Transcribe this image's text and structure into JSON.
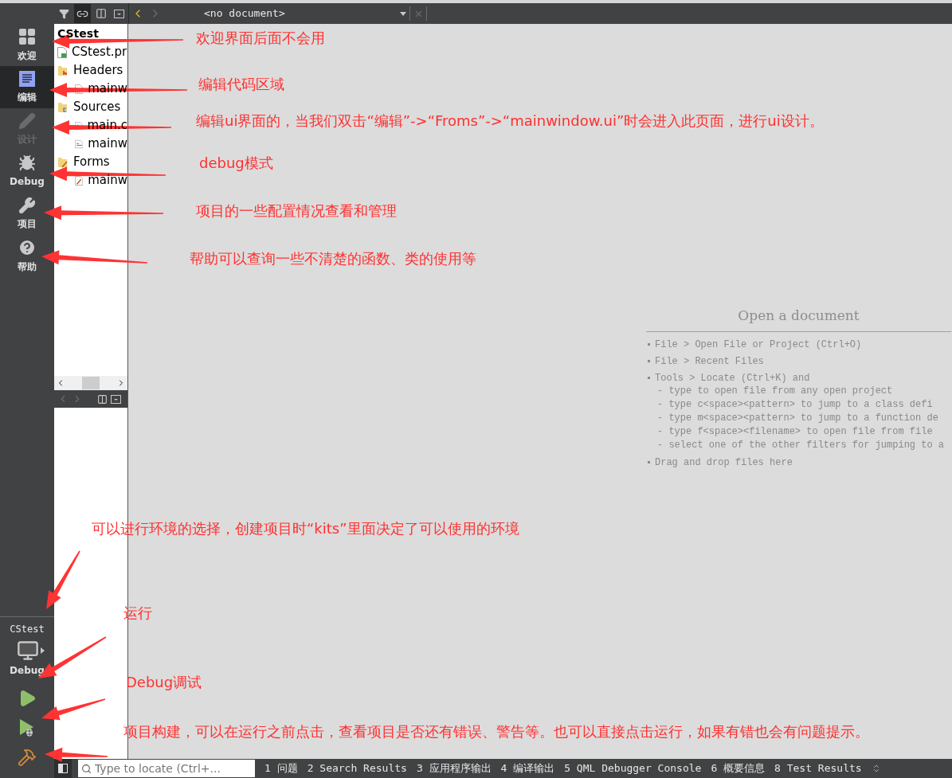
{
  "top_toolbar": {
    "buttons": [
      {
        "kind": "filter",
        "selected": false
      },
      {
        "kind": "link",
        "selected": true
      },
      {
        "kind": "split",
        "selected": false
      },
      {
        "kind": "close-panel",
        "selected": false
      }
    ]
  },
  "editor_toolbar": {
    "nav": [
      {
        "kind": "back",
        "disabled": false
      },
      {
        "kind": "forward",
        "disabled": true
      }
    ],
    "document_combo": {
      "value": "<no document>"
    },
    "close_button": {
      "disabled": true
    }
  },
  "mode_bar": {
    "modes": [
      {
        "label": "欢迎",
        "kind": "welcome",
        "selected": false,
        "disabled": false
      },
      {
        "label": "编辑",
        "kind": "edit",
        "selected": true,
        "disabled": false
      },
      {
        "label": "设计",
        "kind": "design",
        "selected": false,
        "disabled": true
      },
      {
        "label": "Debug",
        "kind": "debug",
        "selected": false,
        "disabled": false
      },
      {
        "label": "项目",
        "kind": "projects",
        "selected": false,
        "disabled": false
      },
      {
        "label": "帮助",
        "kind": "help",
        "selected": false,
        "disabled": false
      }
    ],
    "kit": {
      "project": "CStest",
      "build": "Debug"
    },
    "actions": [
      {
        "kind": "run"
      },
      {
        "kind": "debug-run"
      },
      {
        "kind": "build"
      }
    ]
  },
  "project_tree": {
    "items": [
      {
        "label": "CStest",
        "kind": "project",
        "children": [
          {
            "label": "CStest.pr",
            "kind": "pro-file"
          },
          {
            "label": "Headers",
            "kind": "headers",
            "children": [
              {
                "label": "mainw",
                "kind": "header-file"
              }
            ]
          },
          {
            "label": "Sources",
            "kind": "sources",
            "children": [
              {
                "label": "main.c",
                "kind": "source-file"
              },
              {
                "label": "mainw",
                "kind": "source-file"
              }
            ]
          },
          {
            "label": "Forms",
            "kind": "forms",
            "children": [
              {
                "label": "mainw",
                "kind": "form-file"
              }
            ]
          }
        ]
      }
    ]
  },
  "welcome": {
    "title": "Open a document",
    "items": [
      {
        "text": "File > Open File or Project (Ctrl+O)"
      },
      {
        "text": "File > Recent Files"
      },
      {
        "text": "Tools > Locate (Ctrl+K) and",
        "subitems": [
          "- type to open file from any open project",
          "- type c<space><pattern> to jump to a class defi",
          "- type m<space><pattern> to jump to a function de",
          "- type f<space><filename> to open file from file",
          "- select one of the other filters for jumping to a"
        ]
      },
      {
        "text": "Drag and drop files here"
      }
    ]
  },
  "status_bar": {
    "locator": {
      "placeholder": "Type to locate (Ctrl+..."
    },
    "panes": [
      "1 问题",
      "2 Search Results",
      "3 应用程序输出",
      "4 编译输出",
      "5 QML Debugger Console",
      "6 概要信息",
      "8 Test Results"
    ]
  },
  "annotations": [
    {
      "text": "欢迎界面后面不会用"
    },
    {
      "text": "编辑代码区域"
    },
    {
      "text": "编辑ui界面的，当我们双击“编辑”->“Froms”->“mainwindow.ui”时会进入此页面，进行ui设计。"
    },
    {
      "text": "debug模式"
    },
    {
      "text": "项目的一些配置情况查看和管理"
    },
    {
      "text": "帮助可以查询一些不清楚的函数、类的使用等"
    },
    {
      "text": "可以进行环境的选择，创建项目时“kits”里面决定了可以使用的环境"
    },
    {
      "text": "运行"
    },
    {
      "text": "Debug调试"
    },
    {
      "text": "项目构建，可以在运行之前点击，查看项目是否还有错误、警告等。也可以直接点击运行，如果有错也会有问题提示。"
    }
  ]
}
